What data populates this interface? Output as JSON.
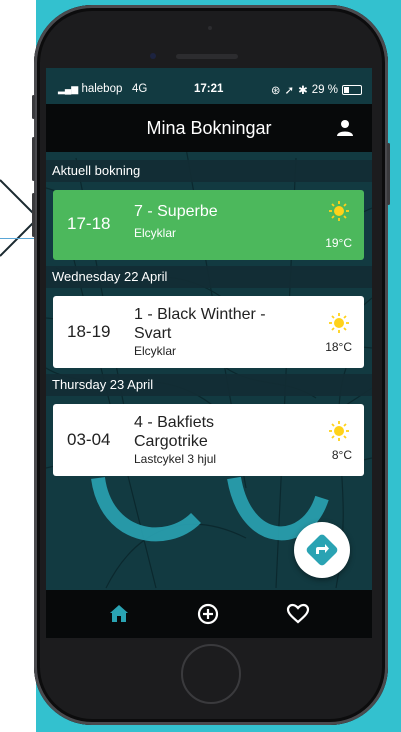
{
  "status_bar": {
    "carrier": "halebop",
    "network": "4G",
    "time": "17:21",
    "battery": "29 %"
  },
  "header": {
    "title": "Mina Bokningar",
    "profile_icon": "person-icon"
  },
  "sections": [
    {
      "label": "Aktuell bokning",
      "bookings": [
        {
          "time": "17-18",
          "title": "7 - Superbe",
          "type": "Elcyklar",
          "weather_icon": "sun-icon",
          "temp": "19°C",
          "status": "current"
        }
      ]
    },
    {
      "label": "Wednesday 22 April",
      "bookings": [
        {
          "time": "18-19",
          "title": "1 - Black Winther -\nSvart",
          "type": "Elcyklar",
          "weather_icon": "sun-icon",
          "temp": "18°C",
          "status": "upcoming"
        }
      ]
    },
    {
      "label": "Thursday 23 April",
      "bookings": [
        {
          "time": "03-04",
          "title": "4 - Bakfiets\nCargotrike",
          "type": "Lastcykel 3 hjul",
          "weather_icon": "sun-icon",
          "temp": "8°C",
          "status": "upcoming"
        }
      ]
    }
  ],
  "fab": {
    "icon": "directions-icon"
  },
  "tab_bar": [
    {
      "icon": "home-icon",
      "active": true
    },
    {
      "icon": "plus-circle-icon",
      "active": false
    },
    {
      "icon": "heart-icon",
      "active": false
    }
  ],
  "colors": {
    "accent": "#2aa3b3",
    "current_booking": "#4cb85c",
    "background_teal": "#33c1cf",
    "sun": "#ffd21a"
  }
}
